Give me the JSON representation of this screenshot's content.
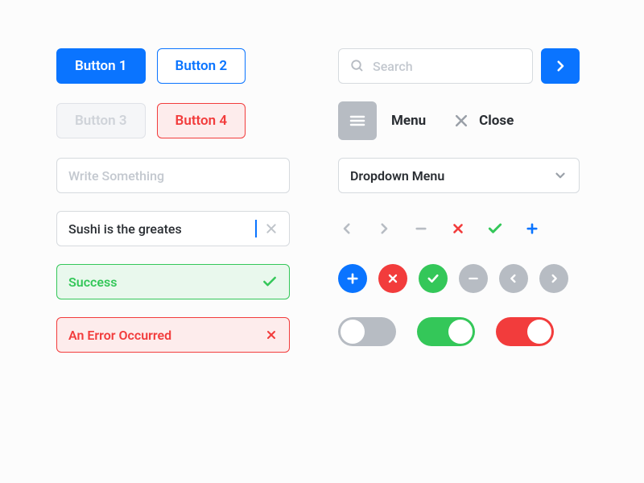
{
  "buttons": {
    "b1": "Button 1",
    "b2": "Button 2",
    "b3": "Button 3",
    "b4": "Button 4"
  },
  "search": {
    "placeholder": "Search"
  },
  "menu": {
    "label": "Menu",
    "close": "Close"
  },
  "text_inputs": {
    "write_placeholder": "Write Something",
    "sushi_value": "Sushi is the greates"
  },
  "dropdown": {
    "label": "Dropdown Menu"
  },
  "alerts": {
    "success": "Success",
    "error": "An Error Occurred"
  }
}
